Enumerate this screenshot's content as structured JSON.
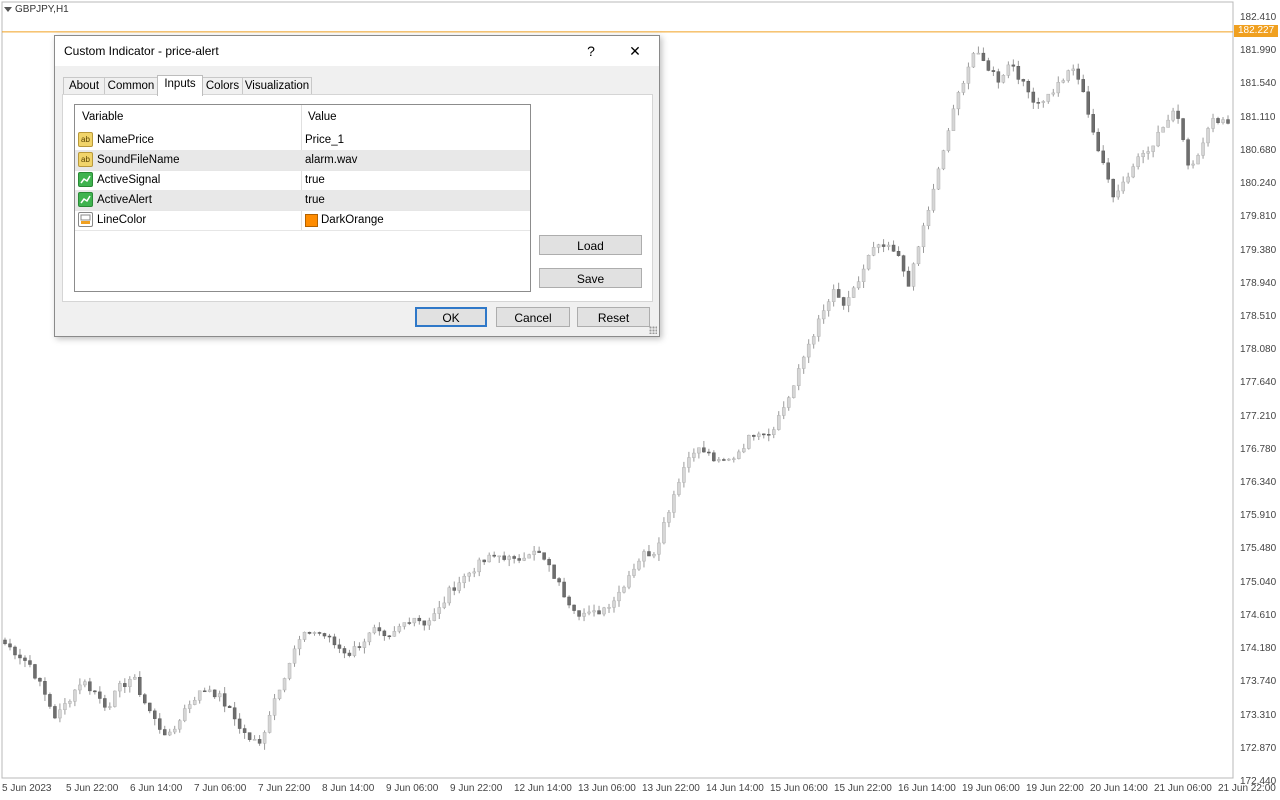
{
  "chart": {
    "symbol": "GBPJPY,H1",
    "current_price": "182.227",
    "line_color": "#f0a020",
    "price_ticks": [
      "182.410",
      "181.990",
      "181.540",
      "181.110",
      "180.680",
      "180.240",
      "179.810",
      "179.380",
      "178.940",
      "178.510",
      "178.080",
      "177.640",
      "177.210",
      "176.780",
      "176.340",
      "175.910",
      "175.480",
      "175.040",
      "174.610",
      "174.180",
      "173.740",
      "173.310",
      "172.870",
      "172.440"
    ],
    "time_ticks": [
      "5 Jun 2023",
      "5 Jun 22:00",
      "6 Jun 14:00",
      "7 Jun 06:00",
      "7 Jun 22:00",
      "8 Jun 14:00",
      "9 Jun 06:00",
      "9 Jun 22:00",
      "12 Jun 14:00",
      "13 Jun 06:00",
      "13 Jun 22:00",
      "14 Jun 14:00",
      "15 Jun 06:00",
      "15 Jun 22:00",
      "16 Jun 14:00",
      "19 Jun 06:00",
      "19 Jun 22:00",
      "20 Jun 14:00",
      "21 Jun 06:00",
      "21 Jun 22:00"
    ]
  },
  "chart_data": {
    "type": "candlestick",
    "ylim": [
      172.44,
      182.41
    ],
    "close_path": [
      174.18,
      174.05,
      173.9,
      173.55,
      173.2,
      173.45,
      173.7,
      173.55,
      173.35,
      173.6,
      173.75,
      173.4,
      173.1,
      172.95,
      173.3,
      173.5,
      173.6,
      173.45,
      173.2,
      172.95,
      172.85,
      173.4,
      173.8,
      174.2,
      174.35,
      174.3,
      174.15,
      174.05,
      174.2,
      174.35,
      174.2,
      174.4,
      174.55,
      174.45,
      174.6,
      174.9,
      175.05,
      175.2,
      175.3,
      175.35,
      175.25,
      175.4,
      175.35,
      175.1,
      174.8,
      174.6,
      174.55,
      174.65,
      174.8,
      175.1,
      175.35,
      175.4,
      175.9,
      176.4,
      176.75,
      176.7,
      176.55,
      176.6,
      176.8,
      177.0,
      176.95,
      177.25,
      177.6,
      178.1,
      178.45,
      178.8,
      178.6,
      178.95,
      179.35,
      179.4,
      179.3,
      178.9,
      179.6,
      180.2,
      180.9,
      181.5,
      181.95,
      181.8,
      181.6,
      181.85,
      181.5,
      181.3,
      181.4,
      181.6,
      181.75,
      181.2,
      180.55,
      180.1,
      180.3,
      180.6,
      180.75,
      181.0,
      181.2,
      180.4,
      180.8,
      181.1,
      181.05
    ],
    "current_price": 182.227
  },
  "dialog": {
    "title": "Custom Indicator - price-alert",
    "help_label": "?",
    "close_label": "✕",
    "tabs": [
      "About",
      "Common",
      "Inputs",
      "Colors",
      "Visualization"
    ],
    "active_tab": "Inputs",
    "grid": {
      "headers": [
        "Variable",
        "Value"
      ],
      "rows": [
        {
          "variable": "NamePrice",
          "value": "Price_1",
          "type": "string"
        },
        {
          "variable": "SoundFileName",
          "value": "alarm.wav",
          "type": "string"
        },
        {
          "variable": "ActiveSignal",
          "value": "true",
          "type": "bool"
        },
        {
          "variable": "ActiveAlert",
          "value": "true",
          "type": "bool"
        },
        {
          "variable": "LineColor",
          "value": "DarkOrange",
          "type": "color",
          "color": "#ff8c00"
        }
      ]
    },
    "buttons": {
      "load": "Load",
      "save": "Save",
      "ok": "OK",
      "cancel": "Cancel",
      "reset": "Reset"
    }
  }
}
